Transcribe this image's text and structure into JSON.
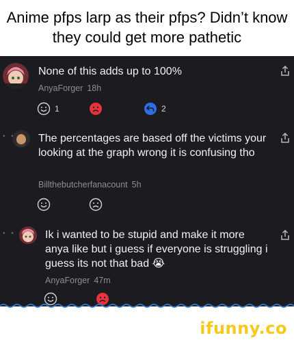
{
  "caption": "Anime pfps larp as their pfps? Didn’t know they could get more pathetic",
  "comments": [
    {
      "text": "None of this adds up to 100%",
      "author": "AnyaForger",
      "time": "18h",
      "reactions": {
        "like_count": "1",
        "reply_count": "2"
      }
    },
    {
      "text": "The percentages are based off the victims your looking at the graph wrong it is confusing tho",
      "author": "Billthebutcherfanacount",
      "time": "5h"
    },
    {
      "text": "Ik i wanted to be stupid and make it more anya like but i guess if everyone is struggling i guess its not that bad 😭",
      "author": "AnyaForger",
      "time": "47m"
    }
  ],
  "thread_indent_marker": "• •",
  "watermark": "ifunny.co",
  "colors": {
    "background": "#1c1b20",
    "dislike_active": "#e8323c",
    "reply_blue": "#2f6fe4",
    "brand_yellow": "#f7c91e",
    "wave_blue": "#2f7fd8"
  }
}
